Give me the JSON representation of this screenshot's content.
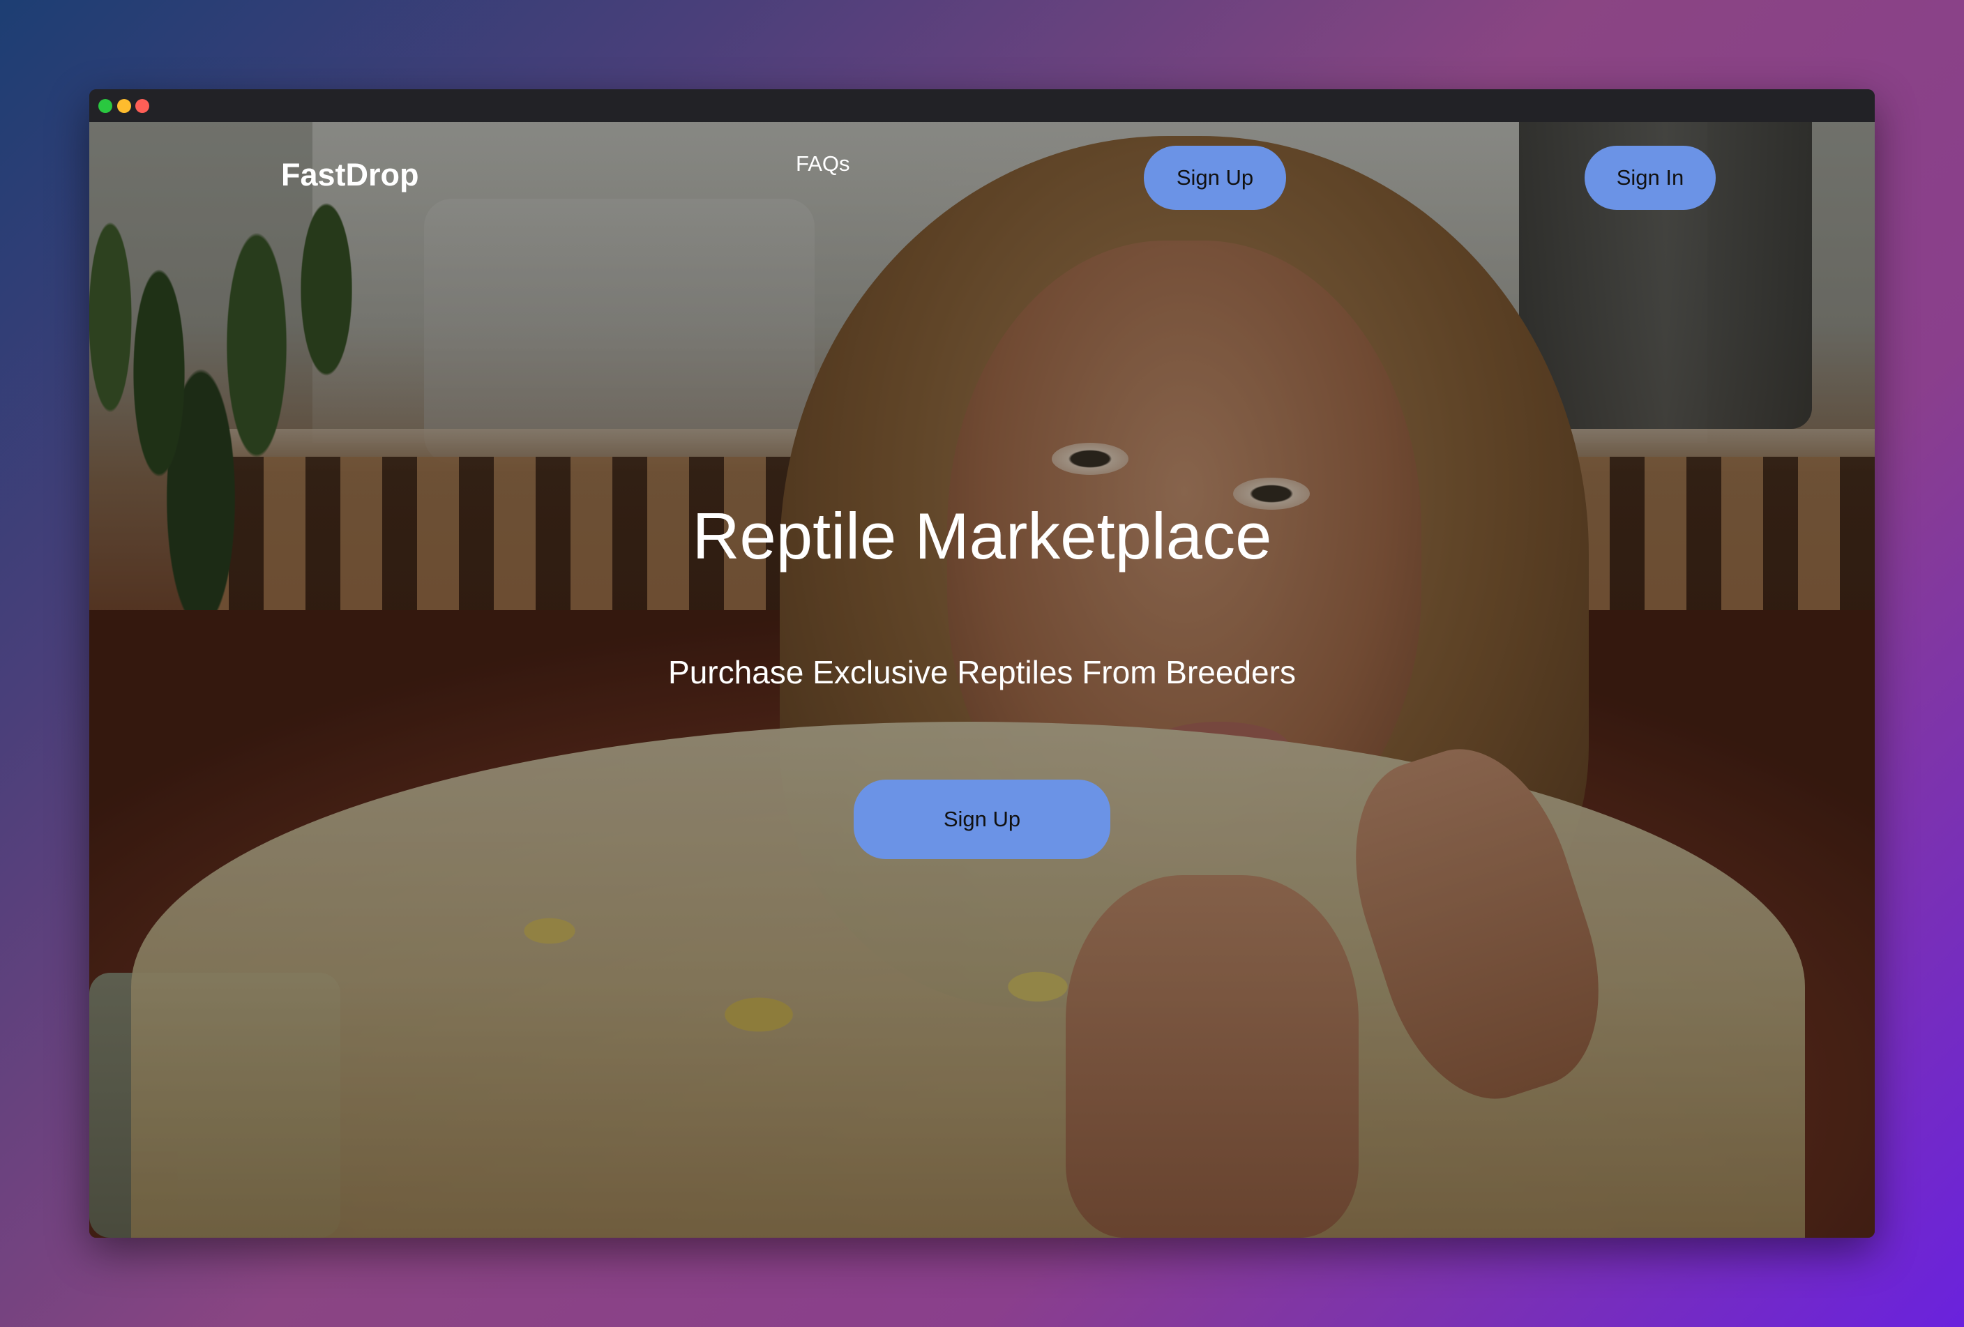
{
  "colors": {
    "titlebar": "#222226",
    "traffic_green": "#2ac840",
    "traffic_yellow": "#febc2e",
    "traffic_red": "#ff5f57",
    "button_bg": "#6b93e6",
    "button_text": "#111111",
    "text_light": "#ffffff"
  },
  "window": {
    "controls": [
      "close-dot",
      "minimize-dot",
      "zoom-dot"
    ]
  },
  "nav": {
    "logo": "FastDrop",
    "faqs_label": "FAQs",
    "signup_label": "Sign Up",
    "signin_label": "Sign In"
  },
  "hero": {
    "title": "Reptile Marketplace",
    "subtitle": "Purchase Exclusive Reptiles From Breeders",
    "cta_label": "Sign Up"
  }
}
